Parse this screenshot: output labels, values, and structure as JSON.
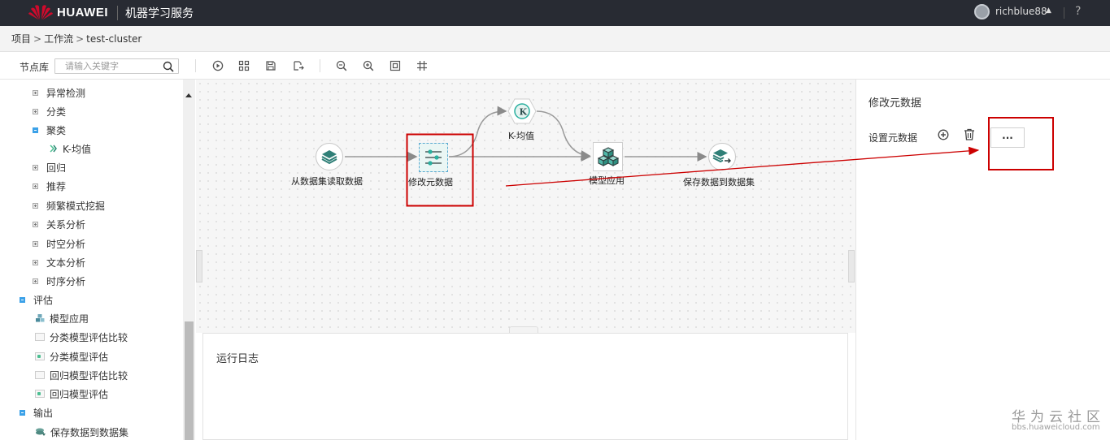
{
  "header": {
    "brand": "HUAWEI",
    "service_name": "机器学习服务",
    "username": "richblue88",
    "help": "?",
    "colors": {
      "background": "#282b33",
      "logo_red": "#cf0a2c"
    }
  },
  "breadcrumb": {
    "items": [
      "项目",
      "工作流",
      "test-cluster"
    ],
    "separator": ">"
  },
  "toolbar": {
    "node_library_label": "节点库",
    "search_placeholder": "请输入关键字",
    "tools": [
      "run-icon",
      "auto-layout-icon",
      "save-icon",
      "export-icon",
      "zoom-out-icon",
      "zoom-in-icon",
      "fit-screen-icon",
      "grid-icon"
    ]
  },
  "sidebar": {
    "items": [
      {
        "label": "异常检测",
        "type": "category",
        "expanded": false
      },
      {
        "label": "分类",
        "type": "category",
        "expanded": false
      },
      {
        "label": "聚类",
        "type": "category",
        "expanded": true
      },
      {
        "label": "K-均值",
        "type": "leaf",
        "icon": "kmeans-icon"
      },
      {
        "label": "回归",
        "type": "category",
        "expanded": false
      },
      {
        "label": "推荐",
        "type": "category",
        "expanded": false
      },
      {
        "label": "频繁模式挖掘",
        "type": "category",
        "expanded": false
      },
      {
        "label": "关系分析",
        "type": "category",
        "expanded": false
      },
      {
        "label": "时空分析",
        "type": "category",
        "expanded": false
      },
      {
        "label": "文本分析",
        "type": "category",
        "expanded": false
      },
      {
        "label": "时序分析",
        "type": "category",
        "expanded": false
      },
      {
        "label": "评估",
        "type": "group",
        "expanded": true
      },
      {
        "label": "模型应用",
        "type": "leaf",
        "icon": "model-apply-icon"
      },
      {
        "label": "分类模型评估比较",
        "type": "leaf",
        "icon": "compare-icon"
      },
      {
        "label": "分类模型评估",
        "type": "leaf",
        "icon": "evaluate-icon"
      },
      {
        "label": "回归模型评估比较",
        "type": "leaf",
        "icon": "compare-icon"
      },
      {
        "label": "回归模型评估",
        "type": "leaf",
        "icon": "evaluate-icon"
      },
      {
        "label": "输出",
        "type": "group",
        "expanded": true
      },
      {
        "label": "保存数据到数据集",
        "type": "leaf",
        "icon": "save-dataset-icon"
      }
    ]
  },
  "canvas": {
    "nodes": [
      {
        "id": "read",
        "label": "从数据集读取数据",
        "icon": "layers-icon"
      },
      {
        "id": "meta",
        "label": "修改元数据",
        "icon": "metadata-icon",
        "selected": true
      },
      {
        "id": "kmeans",
        "label": "K-均值",
        "icon": "kmeans-icon"
      },
      {
        "id": "apply",
        "label": "模型应用",
        "icon": "cubes-icon"
      },
      {
        "id": "save",
        "label": "保存数据到数据集",
        "icon": "save-layers-icon"
      }
    ],
    "accent": "#2bb0a0",
    "highlight_color": "#cc0000"
  },
  "log_panel": {
    "title": "运行日志"
  },
  "properties": {
    "title": "修改元数据",
    "set_metadata_label": "设置元数据",
    "more_button": "···"
  },
  "watermark": {
    "main": "华为云社区",
    "sub": "bbs.huaweicloud.com"
  }
}
